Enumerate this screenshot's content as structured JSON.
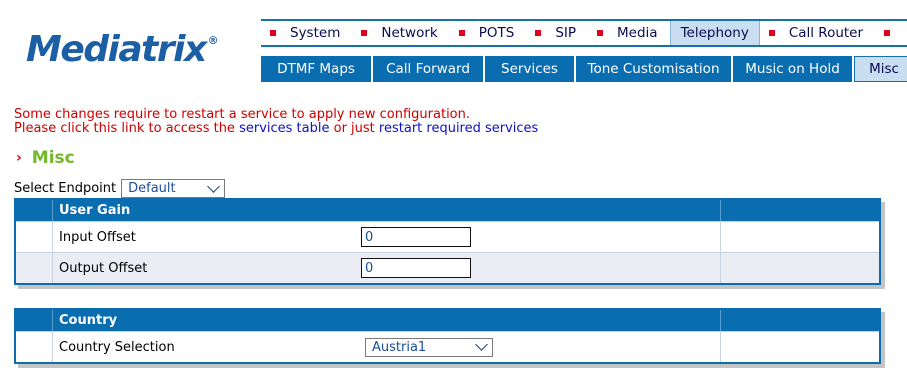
{
  "logo": {
    "text": "Mediatrix",
    "reg": "®"
  },
  "top_menu": [
    {
      "label": "System",
      "active": false
    },
    {
      "label": "Network",
      "active": false
    },
    {
      "label": "POTS",
      "active": false
    },
    {
      "label": "SIP",
      "active": false
    },
    {
      "label": "Media",
      "active": false
    },
    {
      "label": "Telephony",
      "active": true
    },
    {
      "label": "Call Router",
      "active": false
    }
  ],
  "sub_menu": [
    {
      "label": "DTMF Maps",
      "active": false
    },
    {
      "label": "Call Forward",
      "active": false
    },
    {
      "label": "Services",
      "active": false
    },
    {
      "label": "Tone Customisation",
      "active": false
    },
    {
      "label": "Music on Hold",
      "active": false
    },
    {
      "label": "Misc",
      "active": true
    }
  ],
  "notice": {
    "line1": "Some changes require to restart a service to apply new configuration.",
    "line2_prefix": "Please click this link to access the",
    "services_table_link": "services table",
    "line2_middle": "or just",
    "restart_link": "restart required services"
  },
  "section": {
    "title": "Misc"
  },
  "endpoint": {
    "label": "Select Endpoint",
    "value": "Default"
  },
  "user_gain": {
    "header": "User Gain",
    "input_offset_label": "Input Offset",
    "input_offset_value": "0",
    "output_offset_label": "Output Offset",
    "output_offset_value": "0"
  },
  "country": {
    "header": "Country",
    "selection_label": "Country Selection",
    "selection_value": "Austria1"
  },
  "colors": {
    "brand_blue": "#0a6db0",
    "bullet_red": "#e0001b",
    "title_green": "#72b82a",
    "notice_red": "#d00000"
  }
}
